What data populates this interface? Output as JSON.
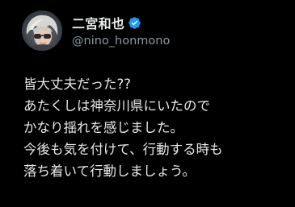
{
  "author": {
    "display_name": "二宮和也",
    "handle": "@nino_honmono",
    "verified_icon": "verified-badge-icon",
    "avatar_icon": "profile-avatar"
  },
  "tweet": {
    "lines": [
      "皆大丈夫だった??",
      "あたくしは神奈川県にいたので",
      "かなり揺れを感じました。",
      "今後も気を付けて、行動する時も",
      "落ち着いて行動しましょう。"
    ]
  },
  "colors": {
    "background": "#000000",
    "text_primary": "#e7e9ea",
    "text_secondary": "#8b98a5",
    "verified_blue": "#1d9bf0"
  }
}
